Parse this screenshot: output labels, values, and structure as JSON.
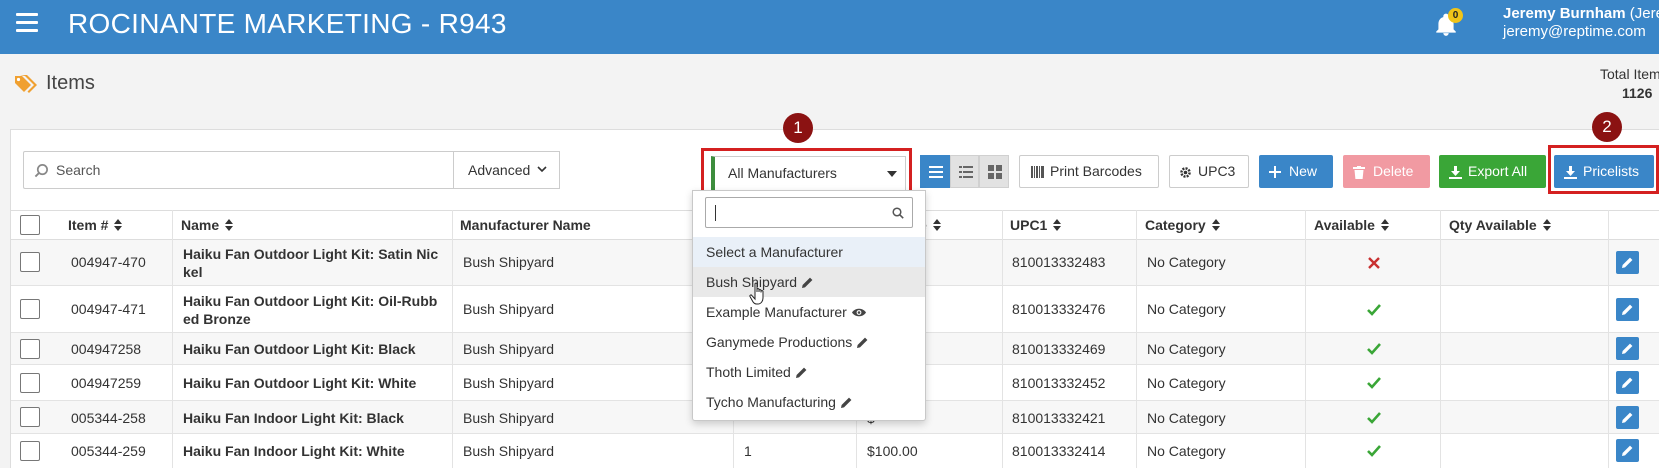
{
  "header": {
    "title": "ROCINANTE MARKETING - R943",
    "notification_count": "0",
    "user_name": "Jeremy Burnham",
    "user_role": " (Jerem",
    "user_email": "jeremy@reptime.com"
  },
  "page": {
    "title": "Items",
    "total_label": "Total Item",
    "total_value": "1126"
  },
  "toolbar": {
    "search_placeholder": "Search",
    "advanced_label": "Advanced",
    "manufacturer_selected": "All Manufacturers",
    "print_barcodes_label": "Print Barcodes",
    "upc_label": "UPC3",
    "new_label": "New",
    "delete_label": "Delete",
    "export_label": "Export All",
    "pricelists_label": "Pricelists"
  },
  "annotations": {
    "step1": "1",
    "step2": "2"
  },
  "dropdown": {
    "search_value": "",
    "hint": "Select a Manufacturer",
    "options": [
      {
        "label": "Bush Shipyard",
        "icon": "pencil-icon"
      },
      {
        "label": "Example Manufacturer",
        "icon": "eye-icon"
      },
      {
        "label": "Ganymede Productions",
        "icon": "pencil-icon"
      },
      {
        "label": "Thoth Limited",
        "icon": "pencil-icon"
      },
      {
        "label": "Tycho Manufacturing",
        "icon": "pencil-icon"
      }
    ]
  },
  "table": {
    "columns": [
      "Item #",
      "Name",
      "Manufacturer Name",
      "",
      "e",
      "UPC1",
      "Category",
      "Available",
      "Qty Available"
    ],
    "rows": [
      {
        "item": "004947-470",
        "name": "Haiku Fan Outdoor Light Kit: Satin Nickel",
        "mfr": "Bush Shipyard",
        "qty": "",
        "price": "",
        "upc": "810013332483",
        "category": "No Category",
        "available": "no"
      },
      {
        "item": "004947-471",
        "name": "Haiku Fan Outdoor Light Kit: Oil-Rubbed Bronze",
        "mfr": "Bush Shipyard",
        "qty": "",
        "price": "",
        "upc": "810013332476",
        "category": "No Category",
        "available": "yes"
      },
      {
        "item": "004947258",
        "name": "Haiku Fan Outdoor Light Kit: Black",
        "mfr": "Bush Shipyard",
        "qty": "",
        "price": "",
        "upc": "810013332469",
        "category": "No Category",
        "available": "yes"
      },
      {
        "item": "004947259",
        "name": "Haiku Fan Outdoor Light Kit: White",
        "mfr": "Bush Shipyard",
        "qty": "",
        "price": "",
        "upc": "810013332452",
        "category": "No Category",
        "available": "yes"
      },
      {
        "item": "005344-258",
        "name": "Haiku Fan Indoor Light Kit: Black",
        "mfr": "Bush Shipyard",
        "qty": "",
        "price": "$",
        "upc": "810013332421",
        "category": "No Category",
        "available": "yes"
      },
      {
        "item": "005344-259",
        "name": "Haiku Fan Indoor Light Kit: White",
        "mfr": "Bush Shipyard",
        "qty": "1",
        "price": "$100.00",
        "upc": "810013332414",
        "category": "No Category",
        "available": "yes"
      }
    ]
  },
  "colors": {
    "brand_blue": "#3a86c8",
    "success_green": "#3aa637",
    "danger_pink": "#f19aa2",
    "highlight_red": "#d42020",
    "step_badge": "#8b1212"
  }
}
